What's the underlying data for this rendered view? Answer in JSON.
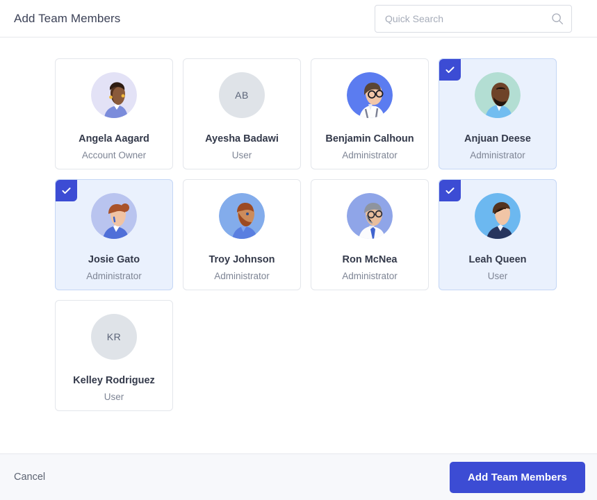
{
  "header": {
    "title": "Add Team Members",
    "search": {
      "placeholder": "Quick Search",
      "value": "",
      "icon": "search-icon"
    }
  },
  "members": [
    {
      "name": "Angela Aagard",
      "role": "Account Owner",
      "selected": false,
      "avatar_type": "illustration",
      "avatar_style": "woman-dark-skin-short-hair",
      "avatar_bg": "#e3e2f6",
      "initials": ""
    },
    {
      "name": "Ayesha Badawi",
      "role": "User",
      "selected": false,
      "avatar_type": "initials",
      "avatar_style": "",
      "avatar_bg": "#dfe3e8",
      "initials": "AB"
    },
    {
      "name": "Benjamin Calhoun",
      "role": "Administrator",
      "selected": false,
      "avatar_type": "illustration",
      "avatar_style": "man-glasses-suspenders",
      "avatar_bg": "#5b7cf0",
      "initials": ""
    },
    {
      "name": "Anjuan Deese",
      "role": "Administrator",
      "selected": true,
      "avatar_type": "illustration",
      "avatar_style": "man-bald-beard-blue-shirt",
      "avatar_bg": "#b3ded3",
      "initials": ""
    },
    {
      "name": "Josie Gato",
      "role": "Administrator",
      "selected": true,
      "avatar_type": "illustration",
      "avatar_style": "woman-auburn-bun-blue-jacket",
      "avatar_bg": "#b9c4ef",
      "initials": ""
    },
    {
      "name": "Troy Johnson",
      "role": "Administrator",
      "selected": false,
      "avatar_type": "illustration",
      "avatar_style": "man-auburn-beard",
      "avatar_bg": "#83aceb",
      "initials": ""
    },
    {
      "name": "Ron McNea",
      "role": "Administrator",
      "selected": false,
      "avatar_type": "illustration",
      "avatar_style": "man-gray-hair-glasses-tie",
      "avatar_bg": "#8fa5e8",
      "initials": ""
    },
    {
      "name": "Leah Queen",
      "role": "User",
      "selected": true,
      "avatar_type": "illustration",
      "avatar_style": "person-quiff-navy-top",
      "avatar_bg": "#6cb8f0",
      "initials": ""
    },
    {
      "name": "Kelley Rodriguez",
      "role": "User",
      "selected": false,
      "avatar_type": "initials",
      "avatar_style": "",
      "avatar_bg": "#dfe3e8",
      "initials": "KR"
    }
  ],
  "footer": {
    "cancel_label": "Cancel",
    "submit_label": "Add Team Members"
  },
  "colors": {
    "accent": "#3c4cd4",
    "selected_card_bg": "#eaf1fd",
    "selected_card_border": "#c4d6f5",
    "card_border": "#e3e6eb",
    "footer_bg": "#f7f8fb",
    "name_text": "#33394a",
    "role_text": "#7d8494"
  }
}
